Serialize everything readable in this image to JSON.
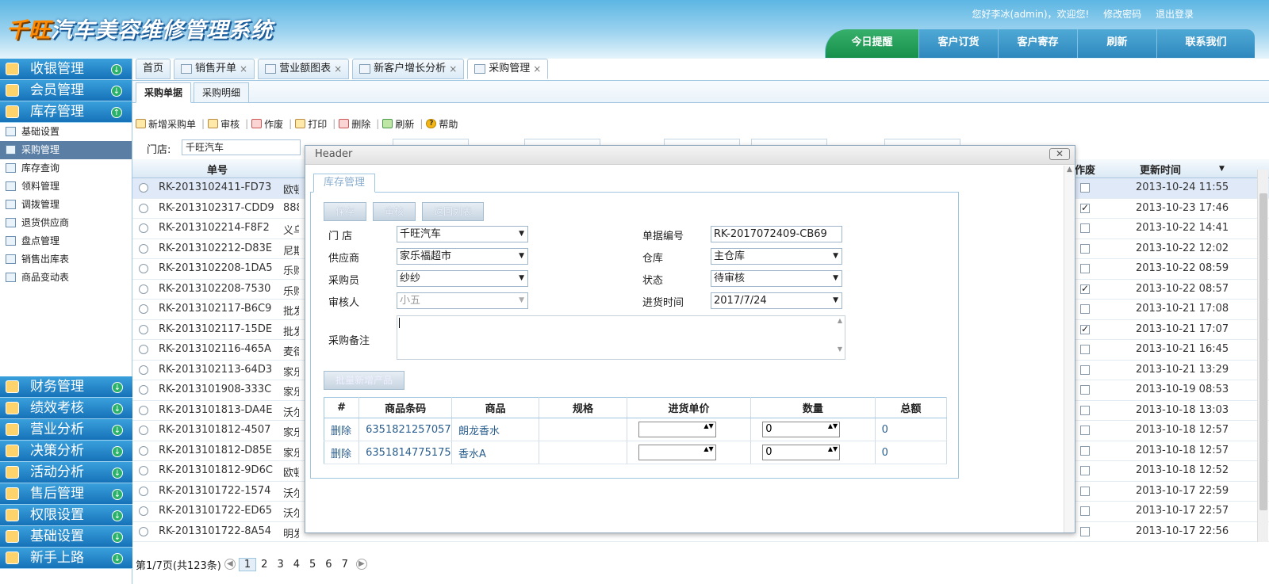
{
  "app": {
    "title_q": "千旺",
    "title_rest": "汽车美容维修管理系统",
    "greeting": "您好李冰(admin)，欢迎您!",
    "change_pwd": "修改密码",
    "logout": "退出登录",
    "nav": [
      "今日提醒",
      "客户订货",
      "客户寄存",
      "刷新",
      "联系我们"
    ]
  },
  "sidebar": {
    "top": [
      {
        "label": "收银管理",
        "arrow": "↓"
      },
      {
        "label": "会员管理",
        "arrow": "↓"
      },
      {
        "label": "库存管理",
        "arrow": "↑"
      }
    ],
    "sub": [
      "基础设置",
      "采购管理",
      "库存查询",
      "领料管理",
      "调拨管理",
      "退货供应商",
      "盘点管理",
      "销售出库表",
      "商品变动表"
    ],
    "bottom": [
      {
        "label": "财务管理",
        "arrow": "↓"
      },
      {
        "label": "绩效考核",
        "arrow": "↓"
      },
      {
        "label": "营业分析",
        "arrow": "↓"
      },
      {
        "label": "决策分析",
        "arrow": "↓"
      },
      {
        "label": "活动分析",
        "arrow": "↓"
      },
      {
        "label": "售后管理",
        "arrow": "↓"
      },
      {
        "label": "权限设置",
        "arrow": "↓"
      },
      {
        "label": "基础设置",
        "arrow": "↓"
      },
      {
        "label": "新手上路",
        "arrow": "↓"
      }
    ]
  },
  "tabs": [
    "首页",
    "销售开单",
    "营业额图表",
    "新客户增长分析",
    "采购管理"
  ],
  "tab_close": "×",
  "subtabs": [
    "采购单据",
    "采购明细"
  ],
  "toolbar": [
    "新增采购单",
    "审核",
    "作废",
    "打印",
    "删除",
    "刷新",
    "帮助"
  ],
  "toolbar_sep": "|",
  "help_icon_glyph": "?",
  "filter": {
    "label": "门店:",
    "value": "千旺汽车"
  },
  "grid": {
    "headers": {
      "code": "单号",
      "void": "作废",
      "updated": "更新时间",
      "sort_glyph": "▼"
    },
    "rows": [
      {
        "code": "RK-2013102411-FD73",
        "sup": "欧顿",
        "void": false,
        "time": "2013-10-24 11:55"
      },
      {
        "code": "RK-2013102317-CDD9",
        "sup": "888",
        "void": true,
        "time": "2013-10-23 17:46"
      },
      {
        "code": "RK-2013102214-F8F2",
        "sup": "义乌",
        "void": false,
        "time": "2013-10-22 14:41"
      },
      {
        "code": "RK-2013102212-D83E",
        "sup": "尼斯",
        "void": false,
        "time": "2013-10-22 12:02"
      },
      {
        "code": "RK-2013102208-1DA5",
        "sup": "乐购",
        "void": false,
        "time": "2013-10-22 08:59"
      },
      {
        "code": "RK-2013102208-7530",
        "sup": "乐购",
        "void": true,
        "time": "2013-10-22 08:57"
      },
      {
        "code": "RK-2013102117-B6C9",
        "sup": "批发",
        "void": false,
        "time": "2013-10-21 17:08"
      },
      {
        "code": "RK-2013102117-15DE",
        "sup": "批发",
        "void": true,
        "time": "2013-10-21 17:07"
      },
      {
        "code": "RK-2013102116-465A",
        "sup": "麦德",
        "void": false,
        "time": "2013-10-21 16:45"
      },
      {
        "code": "RK-2013102113-64D3",
        "sup": "家乐",
        "void": false,
        "time": "2013-10-21 13:29"
      },
      {
        "code": "RK-2013101908-333C",
        "sup": "家乐",
        "void": false,
        "time": "2013-10-19 08:53"
      },
      {
        "code": "RK-2013101813-DA4E",
        "sup": "沃尔",
        "void": false,
        "time": "2013-10-18 13:03"
      },
      {
        "code": "RK-2013101812-4507",
        "sup": "家乐",
        "void": false,
        "time": "2013-10-18 12:57"
      },
      {
        "code": "RK-2013101812-D85E",
        "sup": "家乐",
        "void": false,
        "time": "2013-10-18 12:57"
      },
      {
        "code": "RK-2013101812-9D6C",
        "sup": "欧顿",
        "void": false,
        "time": "2013-10-18 12:52"
      },
      {
        "code": "RK-2013101722-1574",
        "sup": "沃尔",
        "void": false,
        "time": "2013-10-17 22:59"
      },
      {
        "code": "RK-2013101722-ED65",
        "sup": "沃尔",
        "void": false,
        "time": "2013-10-17 22:57"
      },
      {
        "code": "RK-2013101722-8A54",
        "sup": "明发商业广场",
        "void": false,
        "time": "2013-10-17 22:56"
      }
    ],
    "check_glyph": "✓"
  },
  "pager": {
    "info": "第1/7页(共123条)",
    "pages": [
      "1",
      "2",
      "3",
      "4",
      "5",
      "6",
      "7"
    ],
    "prev": "◀",
    "next": "▶"
  },
  "dialog": {
    "title": "Header",
    "close": "✕",
    "form_tab": "库存管理",
    "buttons": [
      "保存",
      "审核",
      "返回列表"
    ],
    "fields": {
      "store_label": "门 店",
      "store": "千旺汽车",
      "supplier_label": "供应商",
      "supplier": "家乐福超市",
      "buyer_label": "采购员",
      "buyer": "纱纱",
      "auditor_label": "审核人",
      "auditor": "小五",
      "docno_label": "单据编号",
      "docno": "RK-2017072409-CB69",
      "wh_label": "仓库",
      "wh": "主仓库",
      "status_label": "状态",
      "status": "待审核",
      "date_label": "进货时间",
      "date": "2017/7/24",
      "remark_label": "采购备注",
      "dd_glyph": "▼"
    },
    "batch_btn": "批量新增产品",
    "table_headers": [
      "#",
      "商品条码",
      "商品",
      "规格",
      "进货单价",
      "数量",
      "总额"
    ],
    "table_rows": [
      {
        "op": "删除",
        "barcode": "6351821257057",
        "name": "朗龙香水",
        "spec": "",
        "price": "",
        "qty": "0",
        "total": "0"
      },
      {
        "op": "删除",
        "barcode": "6351814775175",
        "name": "香水A",
        "spec": "",
        "price": "",
        "qty": "0",
        "total": "0"
      }
    ],
    "spin_glyph": "▲▼",
    "scroll_up": "▲",
    "scroll_down": "▼"
  }
}
